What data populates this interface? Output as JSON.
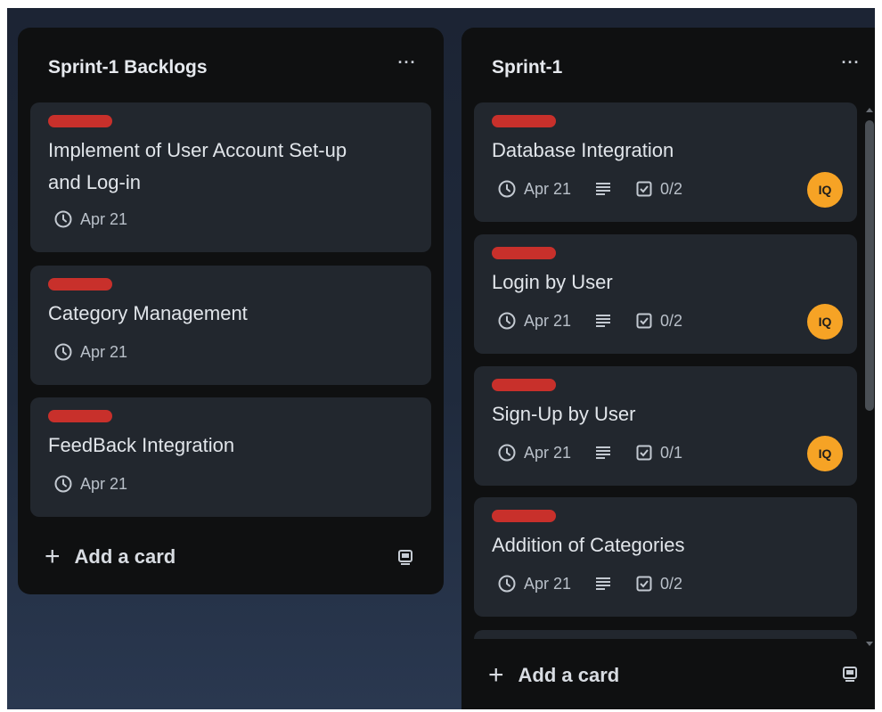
{
  "lists": [
    {
      "title": "Sprint-1 Backlogs",
      "more_label": "···",
      "add_card_label": "Add a card",
      "cards": [
        {
          "title_line1": "Implement of User Account Set-up",
          "title_line2": "and Log-in",
          "date": "Apr 21"
        },
        {
          "title": "Category Management",
          "date": "Apr 21"
        },
        {
          "title": "FeedBack Integration",
          "date": "Apr 21"
        }
      ]
    },
    {
      "title": "Sprint-1",
      "more_label": "···",
      "add_card_label": "Add a card",
      "cards": [
        {
          "title": "Database Integration",
          "date": "Apr 21",
          "checklist": "0/2",
          "avatar": "IQ"
        },
        {
          "title": "Login by User",
          "date": "Apr 21",
          "checklist": "0/2",
          "avatar": "IQ"
        },
        {
          "title": "Sign-Up by User",
          "date": "Apr 21",
          "checklist": "0/1",
          "avatar": "IQ"
        },
        {
          "title": "Addition of Categories",
          "date": "Apr 21",
          "checklist": "0/2"
        }
      ]
    }
  ],
  "colors": {
    "label": "#c8302b",
    "avatar": "#f6a325",
    "list_bg": "#0f1011",
    "card_bg": "#22272e"
  },
  "icons": {
    "due_date": "clock-icon",
    "description": "description-lines-icon",
    "checklist": "checklist-icon",
    "add": "plus-icon",
    "template": "card-template-icon",
    "menu": "more-options-icon"
  }
}
